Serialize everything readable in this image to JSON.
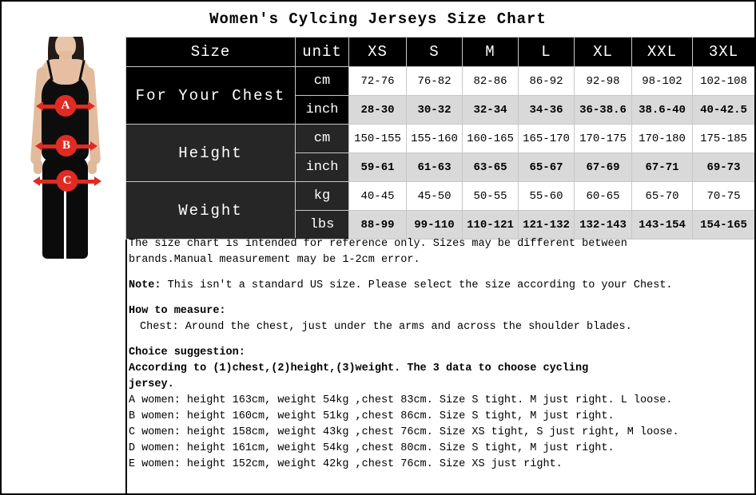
{
  "title": "Women's Cylcing Jerseys Size Chart",
  "figure": {
    "marker_a": "A",
    "marker_b": "B",
    "marker_c": "C"
  },
  "table": {
    "headers": [
      "Size",
      "unit",
      "XS",
      "S",
      "M",
      "L",
      "XL",
      "XXL",
      "3XL"
    ],
    "groups": [
      {
        "label": "For Your Chest",
        "rows": [
          {
            "unit": "cm",
            "values": [
              "72-76",
              "76-82",
              "82-86",
              "86-92",
              "92-98",
              "98-102",
              "102-108"
            ]
          },
          {
            "unit": "inch",
            "values": [
              "28-30",
              "30-32",
              "32-34",
              "34-36",
              "36-38.6",
              "38.6-40",
              "40-42.5"
            ]
          }
        ]
      },
      {
        "label": "Height",
        "rows": [
          {
            "unit": "cm",
            "values": [
              "150-155",
              "155-160",
              "160-165",
              "165-170",
              "170-175",
              "170-180",
              "175-185"
            ]
          },
          {
            "unit": "inch",
            "values": [
              "59-61",
              "61-63",
              "63-65",
              "65-67",
              "67-69",
              "67-71",
              "69-73"
            ]
          }
        ]
      },
      {
        "label": "Weight",
        "rows": [
          {
            "unit": "kg",
            "values": [
              "40-45",
              "45-50",
              "50-55",
              "55-60",
              "60-65",
              "65-70",
              "70-75"
            ]
          },
          {
            "unit": "lbs",
            "values": [
              "88-99",
              "99-110",
              "110-121",
              "121-132",
              "132-143",
              "143-154",
              "154-165"
            ]
          }
        ]
      }
    ]
  },
  "notes": {
    "disclaimer_line1": "The size chart is intended for reference only. Sizes may be different between",
    "disclaimer_line2": "brands.Manual measurement may be 1-2cm error.",
    "note_label": "Note:",
    "note_text": " This isn't a standard US size. Please select the size according to your Chest.",
    "how_to_measure_label": "How to measure:",
    "how_to_measure_chest": "Chest: Around the chest, just under the arms and across the shoulder blades.",
    "choice_label": "Choice suggestion:",
    "choice_line1": "According to (1)chest,(2)height,(3)weight. The 3 data to choose cycling",
    "choice_line2": "jersey.",
    "examples": [
      "A women: height 163cm, weight 54kg ,chest 83cm. Size S tight. M just right. L loose.",
      "B women: height 160cm, weight 51kg ,chest 86cm. Size S tight, M just right.",
      "C women: height 158cm, weight 43kg ,chest 76cm. Size XS tight, S just right, M loose.",
      "D women: height 161cm, weight 54kg ,chest 80cm. Size S tight, M just right.",
      "E women: height 152cm, weight 42kg ,chest 76cm. Size XS just right."
    ]
  },
  "colors": {
    "header_bg": "#000000",
    "label_bg": "#262626",
    "alt_row_bg": "#d9d9d9",
    "marker_red": "#e02b23"
  }
}
